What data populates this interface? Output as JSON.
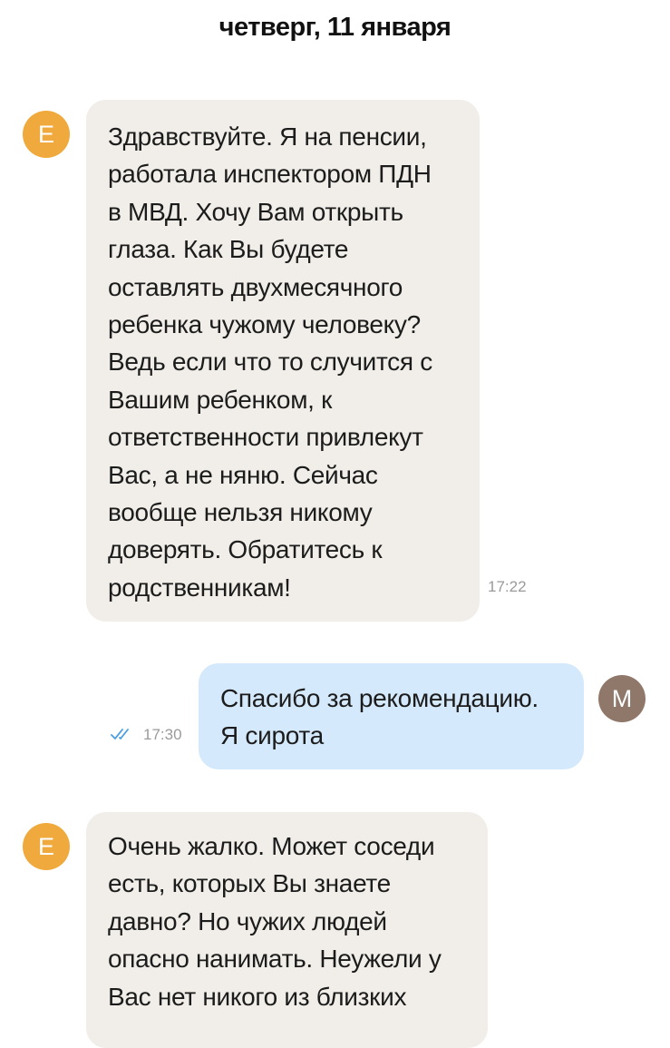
{
  "date_header": "четверг, 11 января",
  "messages": [
    {
      "sender_initial": "Е",
      "direction": "incoming",
      "text": "Здравствуйте. Я на пенсии,\nработала инспектором ПДН\nв МВД. Хочу Вам открыть\nглаза. Как Вы будете\nоставлять двухмесячного\nребенка чужому человеку?\nВедь если что то случится с\nВашим ребенком, к\nответственности привлекут\nВас, а не няню. Сейчас\nвообще нельзя никому\nдоверять. Обратитесь к\nродственникам!",
      "time": "17:22"
    },
    {
      "sender_initial": "М",
      "direction": "outgoing",
      "text": "Спасибо за рекомендацию.\nЯ сирота",
      "time": "17:30",
      "status_icon": "double-check-icon"
    },
    {
      "sender_initial": "Е",
      "direction": "incoming",
      "text": "Очень жалко. Может соседи\nесть, которых Вы знаете\nдавно? Но чужих людей\nопасно нанимать. Неужели у\nВас нет никого из близких"
    }
  ],
  "colors": {
    "incoming_bubble": "#f1eee9",
    "outgoing_bubble": "#d4e9fb",
    "avatar_e": "#f0a93c",
    "avatar_m": "#8f776a",
    "read_check": "#4a9ee0"
  }
}
